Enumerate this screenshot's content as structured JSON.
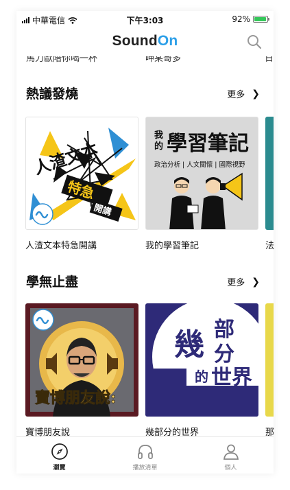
{
  "status_bar": {
    "carrier": "中華電信",
    "time": "下午3:03",
    "battery": "92%"
  },
  "header": {
    "logo_part1": "Sound",
    "logo_part2": "On"
  },
  "previous_row": {
    "left": "馬力歐陪你喝一杯",
    "mid": "呷某哥多",
    "right": "日"
  },
  "sections": [
    {
      "title": "熱議發燒",
      "more_label": "更多",
      "items": [
        {
          "title": "人渣文本特急開講",
          "cover_text": [
            "人渣文本",
            "特急",
            "開講"
          ]
        },
        {
          "title": "我的學習筆記",
          "cover_text": [
            "我的",
            "學習筆記",
            "政治分析",
            "人文關懷",
            "國際視野"
          ]
        },
        {
          "title": "法"
        }
      ]
    },
    {
      "title": "學無止盡",
      "more_label": "更多",
      "items": [
        {
          "title": "寶博朋友說",
          "cover_text": "寶博朋友說:"
        },
        {
          "title": "幾部分的世界",
          "cover_text": [
            "幾",
            "部",
            "分",
            "的世界"
          ]
        },
        {
          "title": "那"
        }
      ]
    }
  ],
  "tabbar": [
    {
      "label": "瀏覽",
      "icon": "compass-icon",
      "active": true
    },
    {
      "label": "播放清單",
      "icon": "headphones-icon",
      "active": false
    },
    {
      "label": "個人",
      "icon": "person-icon",
      "active": false
    }
  ],
  "colors": {
    "brand_blue": "#2c9fe8",
    "cover1_yellow": "#f5c518",
    "cover2_bg": "#d9d9d9",
    "cover3_frame": "#5a1a22",
    "cover4_navy": "#2e2a78"
  }
}
